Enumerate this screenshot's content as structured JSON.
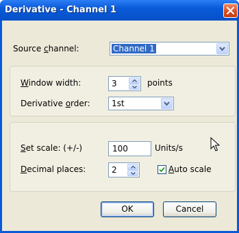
{
  "window": {
    "title": "Derivative - Channel 1",
    "close_icon": "close-icon"
  },
  "source": {
    "label": "Source channel:",
    "label_underline": "c",
    "value": "Channel 1"
  },
  "window_width": {
    "label": "Window width:",
    "value": "3",
    "unit": "points"
  },
  "derivative_order": {
    "label": "Derivative order:",
    "value": "1st"
  },
  "set_scale": {
    "label": "Set scale: (+/-)",
    "value": "100",
    "unit": "Units/s"
  },
  "decimal_places": {
    "label": "Decimal places:",
    "value": "2"
  },
  "auto_scale": {
    "label": "Auto scale",
    "checked": true
  },
  "buttons": {
    "ok": "OK",
    "cancel": "Cancel"
  },
  "colors": {
    "titlebar": "#0a5ad8",
    "dialog_bg": "#ece9d8",
    "selection": "#316ac5",
    "close": "#d54a1f"
  }
}
